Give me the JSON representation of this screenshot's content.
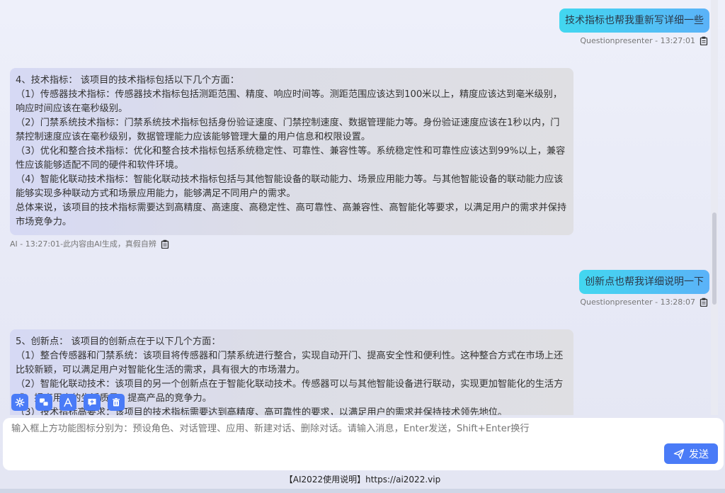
{
  "messages": {
    "user1": {
      "text": "技术指标也帮我重新写详细一些",
      "meta": "Questionpresenter - 13:27:01"
    },
    "ai1": {
      "lines": [
        "4、技术指标： 该项目的技术指标包括以下几个方面：",
        "（1）传感器技术指标：传感器技术指标包括测距范围、精度、响应时间等。测距范围应该达到100米以上，精度应该达到毫米级别，响应时间应该在毫秒级别。",
        "（2）门禁系统技术指标：门禁系统技术指标包括身份验证速度、门禁控制速度、数据管理能力等。身份验证速度应该在1秒以内，门禁控制速度应该在毫秒级别，数据管理能力应该能够管理大量的用户信息和权限设置。",
        "（3）优化和整合技术指标：优化和整合技术指标包括系统稳定性、可靠性、兼容性等。系统稳定性和可靠性应该达到99%以上，兼容性应该能够适配不同的硬件和软件环境。",
        "（4）智能化联动技术指标：智能化联动技术指标包括与其他智能设备的联动能力、场景应用能力等。与其他智能设备的联动能力应该能够实现多种联动方式和场景应用能力，能够满足不同用户的需求。",
        "总体来说，该项目的技术指标需要达到高精度、高速度、高稳定性、高可靠性、高兼容性、高智能化等要求，以满足用户的需求并保持市场竞争力。"
      ],
      "meta": "AI - 13:27:01-此内容由AI生成，真假自辨"
    },
    "user2": {
      "text": "创新点也帮我详细说明一下",
      "meta": "Questionpresenter - 13:28:07"
    },
    "ai2": {
      "lines": [
        "5、创新点： 该项目的创新点在于以下几个方面：",
        "（1）整合传感器和门禁系统：该项目将传感器和门禁系统进行整合，实现自动开门、提高安全性和便利性。这种整合方式在市场上还比较新颖，可以满足用户对智能化生活的需求，具有很大的市场潜力。",
        "（2）智能化联动技术：该项目的另一个创新点在于智能化联动技术。传感器可以与其他智能设备进行联动，实现更加智能化的生活方式，提高用户的生活质量，提高产品的竞争力。",
        "（3）技术指标高要求：该项目的技术指标需要达到高精度、高可靠性的要求，以满足用户的需求并保持技术领先地位。"
      ]
    }
  },
  "toolbar": {
    "icons": [
      "gear-icon",
      "conversation-icon",
      "apps-icon",
      "new-chat-icon",
      "delete-icon"
    ]
  },
  "input": {
    "placeholder": "输入框上方功能图标分别为：预设角色、对话管理、应用、新建对话、删除对话。请输入消息，Enter发送，Shift+Enter换行"
  },
  "send_label": "发送",
  "footer": "【AI2022使用说明】https://ai2022.vip",
  "colors": {
    "accent": "#4a7bf7",
    "user_bubble_start": "#42d7f0",
    "user_bubble_end": "#5bb2f8"
  }
}
